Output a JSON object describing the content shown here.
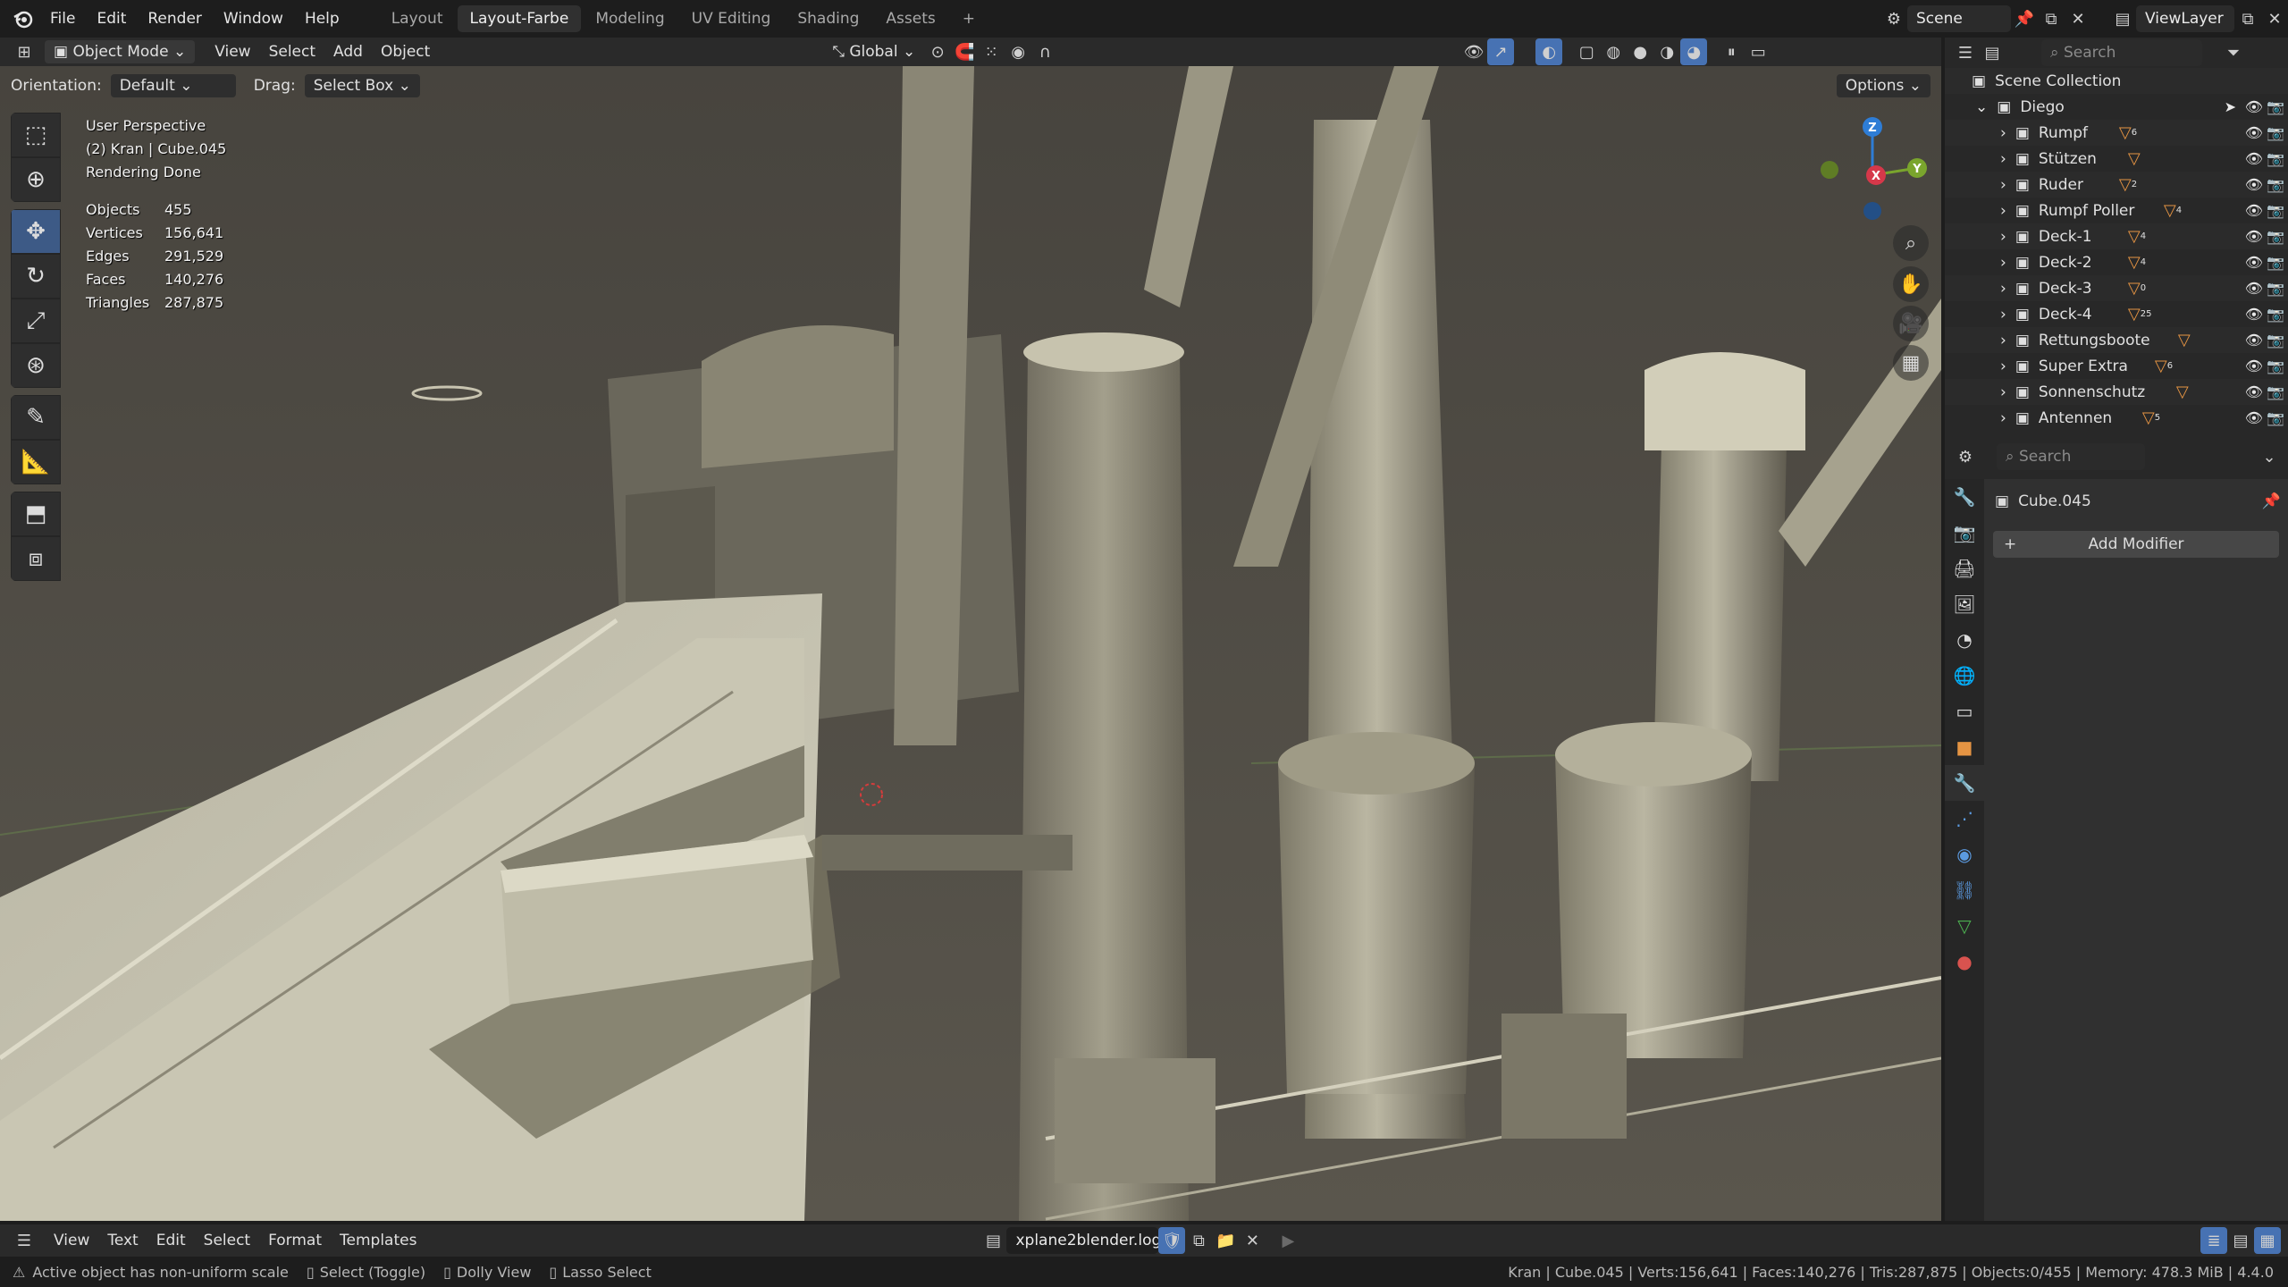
{
  "topbar": {
    "menus": [
      "File",
      "Edit",
      "Render",
      "Window",
      "Help"
    ],
    "workspaces": [
      "Layout",
      "Layout-Farbe",
      "Modeling",
      "UV Editing",
      "Shading",
      "Assets"
    ],
    "active_workspace": "Layout-Farbe",
    "add_workspace": "+",
    "scene": "Scene",
    "view_layer": "ViewLayer"
  },
  "viewport_header": {
    "mode": "Object Mode",
    "menus": [
      "View",
      "Select",
      "Add",
      "Object"
    ],
    "transform_orientation": "Global",
    "orientation_label": "Orientation:",
    "orientation_value": "Default",
    "drag_label": "Drag:",
    "drag_value": "Select Box",
    "options": "Options"
  },
  "viewport_overlay": {
    "perspective": "User Perspective",
    "object_info": "(2) Kran | Cube.045",
    "render_status": "Rendering Done",
    "stats": [
      {
        "label": "Objects",
        "value": "455"
      },
      {
        "label": "Vertices",
        "value": "156,641"
      },
      {
        "label": "Edges",
        "value": "291,529"
      },
      {
        "label": "Faces",
        "value": "140,276"
      },
      {
        "label": "Triangles",
        "value": "287,875"
      }
    ]
  },
  "gizmo": {
    "x": "X",
    "y": "Y",
    "z": "Z"
  },
  "outliner": {
    "search_placeholder": "Search",
    "scene_collection": "Scene Collection",
    "root": "Diego",
    "items": [
      {
        "label": "Rumpf",
        "count": "6"
      },
      {
        "label": "Stützen",
        "count": ""
      },
      {
        "label": "Ruder",
        "count": "2"
      },
      {
        "label": "Rumpf Poller",
        "count": "4"
      },
      {
        "label": "Deck-1",
        "count": "4"
      },
      {
        "label": "Deck-2",
        "count": "4"
      },
      {
        "label": "Deck-3",
        "count": "0"
      },
      {
        "label": "Deck-4",
        "count": "25"
      },
      {
        "label": "Rettungsboote",
        "count": ""
      },
      {
        "label": "Super Extra",
        "count": "6"
      },
      {
        "label": "Sonnenschutz",
        "count": ""
      },
      {
        "label": "Antennen",
        "count": "5"
      }
    ]
  },
  "properties": {
    "search_placeholder": "Search",
    "object_name": "Cube.045",
    "add_modifier": "Add Modifier"
  },
  "text_editor": {
    "menus": [
      "View",
      "Text",
      "Edit",
      "Select",
      "Format",
      "Templates"
    ],
    "filename": "xplane2blender.log"
  },
  "statusbar": {
    "warning": "Active object has non-uniform scale",
    "hint1": "Select (Toggle)",
    "hint2": "Dolly View",
    "hint3": "Lasso Select",
    "info": "Kran | Cube.045 | Verts:156,641 | Faces:140,276 | Tris:287,875 | Objects:0/455 | Memory: 478.3 MiB | 4.4.0"
  },
  "colors": {
    "accent": "#4772b3",
    "header": "#2a2a2a",
    "viewport": "#545048",
    "collection_icon": "#e59443"
  }
}
